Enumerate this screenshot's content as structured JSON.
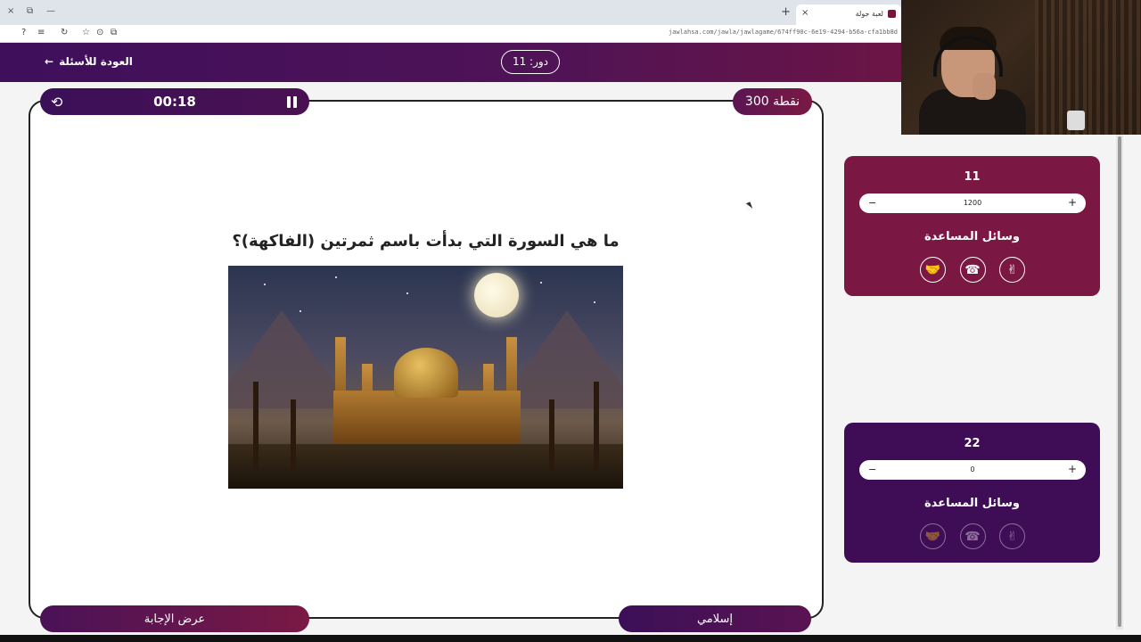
{
  "browser": {
    "tab_title": "لعبة جولة",
    "url": "jawlahsa.com/jawla/jawlagame/674ff90c-6e19-4294-b56a-cfa1bb8d",
    "window_buttons": [
      "×",
      "⧉",
      "—"
    ],
    "new_tab": "+",
    "tab_close": "×",
    "nav": [
      "?",
      "≡",
      "↻",
      "☆",
      "⊙",
      "⧉"
    ]
  },
  "header": {
    "back_label": "العودة للأسئلة",
    "back_arrow": "←",
    "round_label": "دور: 11"
  },
  "game": {
    "timer": "00:18",
    "reset_icon": "⟲",
    "points": "300 نقطة",
    "question": "ما هي السورة التي بدأت باسم ثمرتين (الفاكهة)؟",
    "show_answer_label": "عرض الإجابة",
    "category": "إسلامي"
  },
  "teams": [
    {
      "name": "11",
      "score_value": "1200",
      "minus": "−",
      "plus": "+",
      "helpers_title": "وسائل المساعدة",
      "helpers": [
        {
          "icon": "handshake-icon",
          "glyph": "🤝"
        },
        {
          "icon": "phone-icon",
          "glyph": "☎"
        },
        {
          "icon": "victory-hand-icon",
          "glyph": "✌"
        }
      ]
    },
    {
      "name": "22",
      "score_value": "0",
      "minus": "−",
      "plus": "+",
      "helpers_title": "وسائل المساعدة",
      "helpers": [
        {
          "icon": "handshake-icon",
          "glyph": "🤝"
        },
        {
          "icon": "phone-icon",
          "glyph": "☎"
        },
        {
          "icon": "victory-hand-icon",
          "glyph": "✌"
        }
      ]
    }
  ],
  "colors": {
    "header": "#4f1356",
    "team1": "#7a1742",
    "team2": "#3e0d55",
    "accent": "#7a1944"
  }
}
